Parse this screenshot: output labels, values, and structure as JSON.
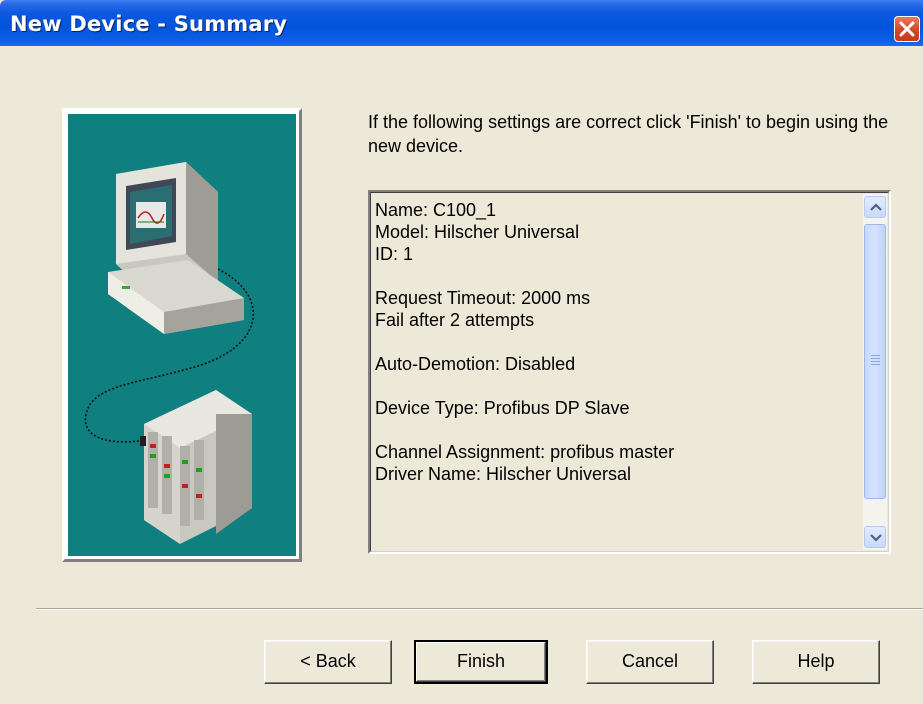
{
  "window": {
    "title": "New Device - Summary",
    "close_icon": "close-icon"
  },
  "instruction": "If the following settings are correct click 'Finish' to begin using the new device.",
  "summary": {
    "lines": [
      "Name: C100_1",
      "Model: Hilscher Universal",
      "ID: 1",
      "",
      "Request Timeout: 2000 ms",
      "Fail after 2 attempts",
      "",
      "Auto-Demotion: Disabled",
      "",
      "Device Type: Profibus DP Slave",
      "",
      "Channel Assignment: profibus master",
      "Driver Name: Hilscher Universal"
    ]
  },
  "buttons": {
    "back": "< Back",
    "finish": "Finish",
    "cancel": "Cancel",
    "help": "Help"
  },
  "colors": {
    "title_bar": "#0454DB",
    "illustration_bg": "#0F7F7F",
    "dialog_bg": "#ECE9D8"
  }
}
